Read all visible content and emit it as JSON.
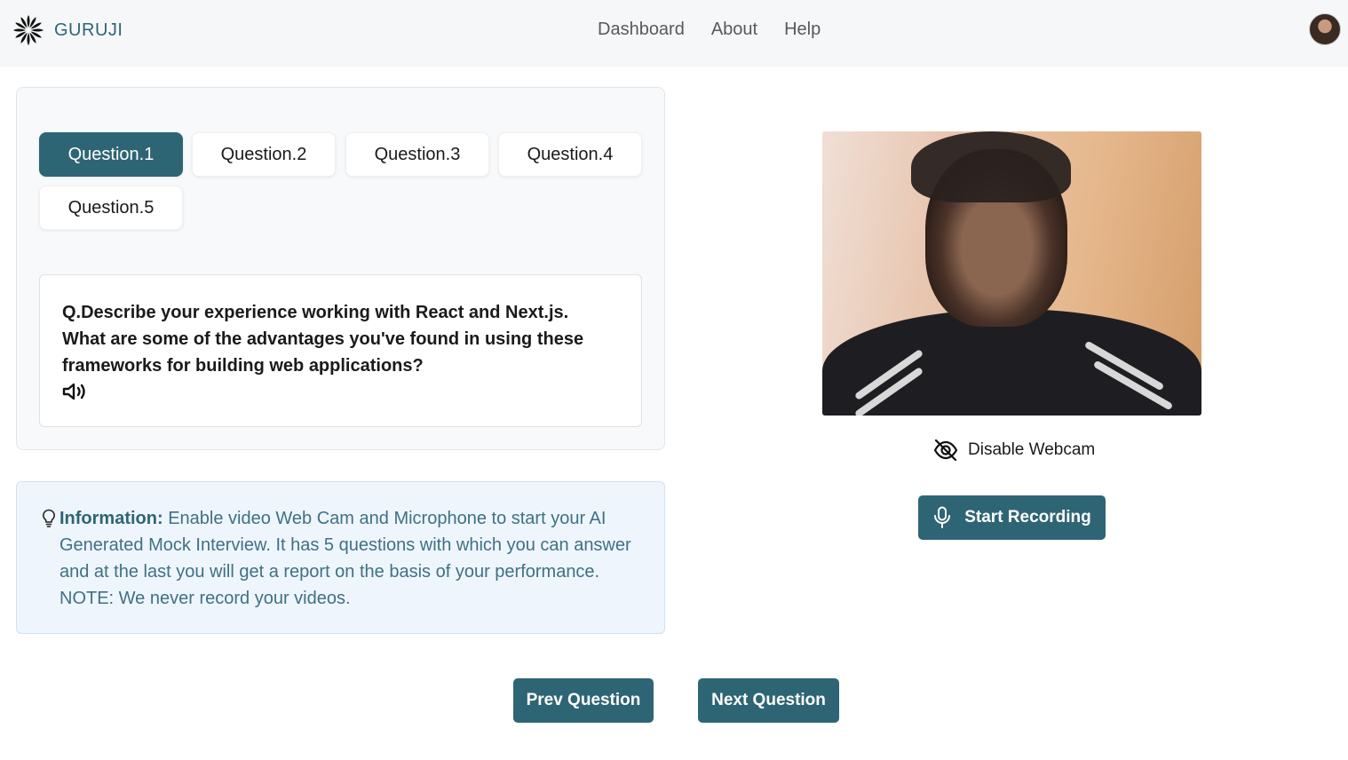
{
  "app": {
    "name": "GURUJI"
  },
  "nav": {
    "items": [
      "Dashboard",
      "About",
      "Help"
    ]
  },
  "questions": {
    "tabs": [
      "Question.1",
      "Question.2",
      "Question.3",
      "Question.4",
      "Question.5"
    ],
    "active_index": 0,
    "current_text": "Q.Describe your experience working with React and Next.js. What are some of the advantages you've found in using these frameworks for building web applications?"
  },
  "info": {
    "label": "Information:",
    "text": "Enable video Web Cam and Microphone to start your AI Generated Mock Interview. It has 5 questions with which you can answer and at the last you will get a report on the basis of your performance. NOTE: We never record your videos."
  },
  "webcam": {
    "toggle_label": "Disable Webcam"
  },
  "record": {
    "label": "Start Recording"
  },
  "pager": {
    "prev_label": "Prev Question",
    "next_label": "Next Question"
  },
  "colors": {
    "primary": "#2e6575",
    "info_bg": "#eef5fd",
    "header_bg": "#f6f7f8"
  }
}
